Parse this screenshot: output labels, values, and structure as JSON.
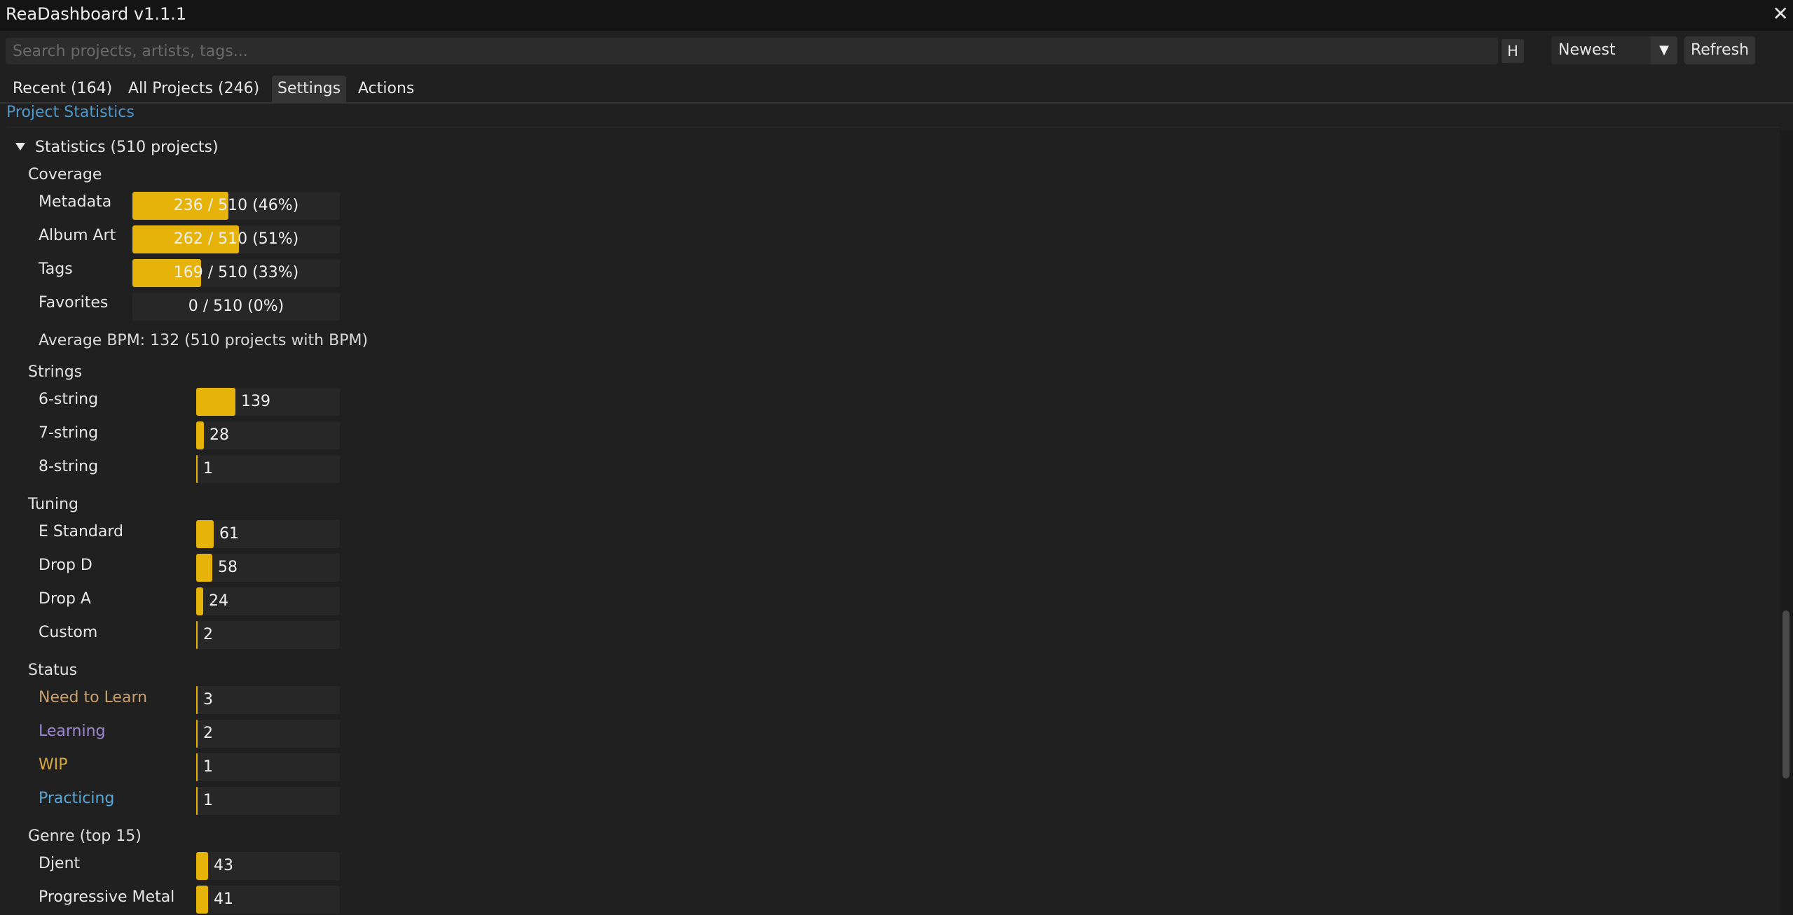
{
  "window": {
    "title": "ReaDashboard v1.1.1",
    "close_glyph": "✕"
  },
  "search": {
    "placeholder": "Search projects, artists, tags...",
    "value": ""
  },
  "toolbar": {
    "h_label": "H",
    "sort_value": "Newest",
    "sort_arrow": "▼",
    "refresh_label": "Refresh"
  },
  "tabs": [
    {
      "label": "Recent (164)",
      "active": false
    },
    {
      "label": "All Projects (246)",
      "active": false
    },
    {
      "label": "Settings",
      "active": true
    },
    {
      "label": "Actions",
      "active": false
    }
  ],
  "section": {
    "title": "Project Statistics"
  },
  "statistics": {
    "node_label": "Statistics (510 projects)",
    "coverage": {
      "title": "Coverage",
      "items": [
        {
          "label": "Metadata",
          "count": 236,
          "total": 510,
          "text": "236 / 510  (46%)"
        },
        {
          "label": "Album Art",
          "count": 262,
          "total": 510,
          "text": "262 / 510  (51%)"
        },
        {
          "label": "Tags",
          "count": 169,
          "total": 510,
          "text": "169 / 510  (33%)"
        },
        {
          "label": "Favorites",
          "count": 0,
          "total": 510,
          "text": "0 / 510  (0%)"
        }
      ]
    },
    "avg_bpm": "Average BPM: 132  (510 projects with BPM)",
    "strings": {
      "title": "Strings",
      "items": [
        {
          "label": "6-string",
          "value": 139
        },
        {
          "label": "7-string",
          "value": 28
        },
        {
          "label": "8-string",
          "value": 1
        }
      ]
    },
    "tuning": {
      "title": "Tuning",
      "items": [
        {
          "label": "E Standard",
          "value": 61
        },
        {
          "label": "Drop D",
          "value": 58
        },
        {
          "label": "Drop A",
          "value": 24
        },
        {
          "label": "Custom",
          "value": 2
        }
      ]
    },
    "status": {
      "title": "Status",
      "items": [
        {
          "label": "Need to Learn",
          "value": 3,
          "color": "#c8a070"
        },
        {
          "label": "Learning",
          "value": 2,
          "color": "#9a88d0"
        },
        {
          "label": "WIP",
          "value": 1,
          "color": "#d8a83a"
        },
        {
          "label": "Practicing",
          "value": 1,
          "color": "#5aa8d8"
        }
      ]
    },
    "genre": {
      "title": "Genre (top 15)",
      "items": [
        {
          "label": "Djent",
          "value": 43
        },
        {
          "label": "Progressive Metal",
          "value": 41
        }
      ]
    }
  },
  "colors": {
    "accent": "#e6b30b",
    "link": "#4f97c8",
    "background": "#202020"
  }
}
